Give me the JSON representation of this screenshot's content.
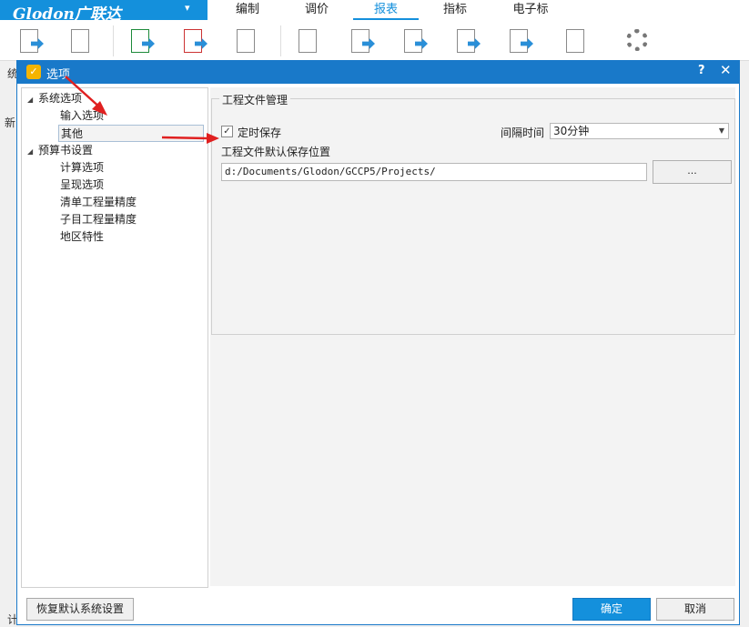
{
  "app": {
    "logo_text": "Glodon广联达",
    "logo_dropdown": "▾",
    "menu_tabs": [
      "编制",
      "调价",
      "报表",
      "指标",
      "电子标"
    ],
    "active_tab": "报表",
    "brand_color": "#1490dc"
  },
  "background_fragments": {
    "left_1": "统",
    "left_2": "新",
    "left_bottom": "计"
  },
  "dialog": {
    "title": "选项",
    "help_label": "?",
    "close_label": "✕",
    "tree": [
      {
        "label": "系统选项",
        "level": 0,
        "expanded": true
      },
      {
        "label": "输入选项",
        "level": 1
      },
      {
        "label": "其他",
        "level": 1,
        "selected": true
      },
      {
        "label": "预算书设置",
        "level": 0,
        "expanded": true
      },
      {
        "label": "计算选项",
        "level": 1
      },
      {
        "label": "呈现选项",
        "level": 1
      },
      {
        "label": "清单工程量精度",
        "level": 1
      },
      {
        "label": "子目工程量精度",
        "level": 1
      },
      {
        "label": "地区特性",
        "level": 1
      }
    ],
    "group": {
      "title": "工程文件管理",
      "autosave_label": "定时保存",
      "autosave_checked": "✓",
      "interval_label": "间隔时间",
      "interval_value": "30分钟",
      "default_path_label": "工程文件默认保存位置",
      "default_path_value": "d:/Documents/Glodon/GCCP5/Projects/",
      "browse_label": "..."
    },
    "buttons": {
      "restore_defaults": "恢复默认系统设置",
      "ok": "确定",
      "cancel": "取消"
    }
  }
}
